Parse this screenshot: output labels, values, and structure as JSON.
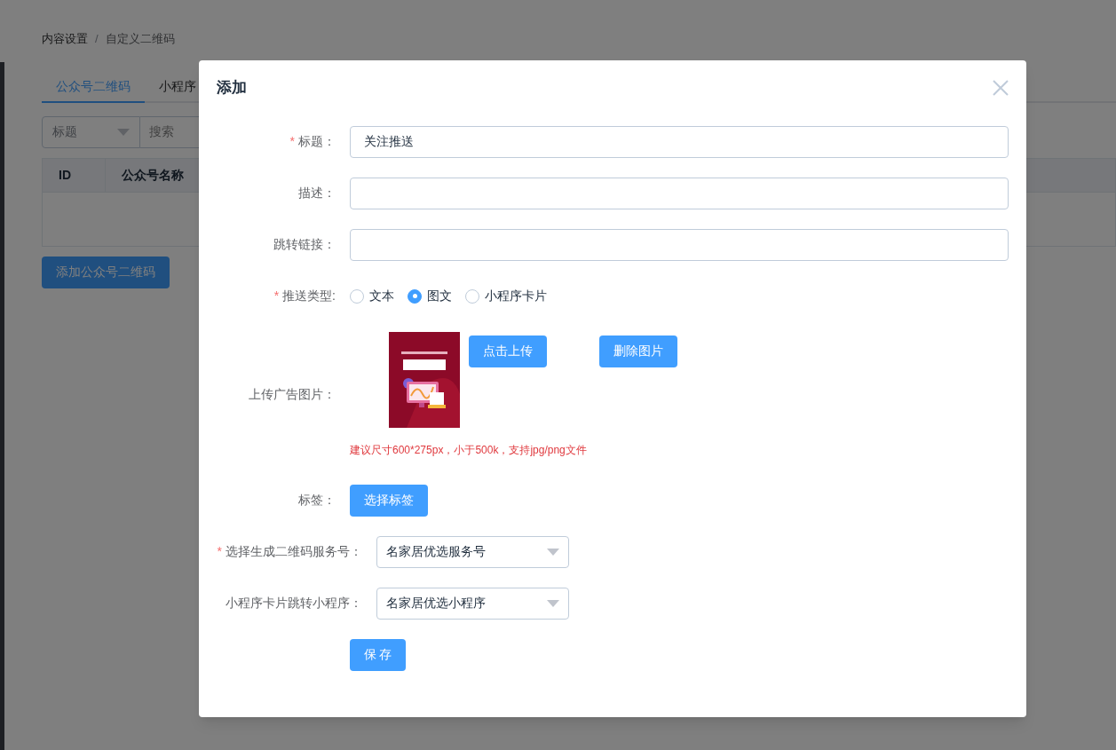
{
  "breadcrumb": [
    {
      "label": "内容设置"
    },
    {
      "label": "自定义二维码"
    }
  ],
  "breadcrumb_separator": "/",
  "tabs": [
    {
      "label": "公众号二维码",
      "selected": true
    },
    {
      "label": "小程序",
      "selected": false
    }
  ],
  "filter": {
    "select_value": "标题",
    "search_placeholder": "搜索"
  },
  "table": {
    "columns": [
      "ID",
      "公众号名称"
    ]
  },
  "add_button": "添加公众号二维码",
  "dialog": {
    "title": "添加",
    "fields": [
      {
        "kind": "input",
        "label": "标题：",
        "required": true,
        "value": "关注推送"
      },
      {
        "kind": "input",
        "label": "描述：",
        "required": false
      },
      {
        "kind": "input",
        "label": "跳转链接：",
        "required": false
      },
      {
        "kind": "radio",
        "label": "推送类型:",
        "required": true,
        "options": [
          {
            "label": "文本",
            "selected": false
          },
          {
            "label": "图文",
            "selected": true
          },
          {
            "label": "小程序卡片",
            "selected": false
          }
        ]
      },
      {
        "kind": "upload",
        "label": "上传广告图片：",
        "required": false,
        "buttons": [
          "点击上传",
          "删除图片"
        ],
        "hint": "建议尺寸600*275px，小于500k，支持jpg/png文件"
      },
      {
        "kind": "button",
        "label": "标签：",
        "required": false,
        "button": "选择标签"
      },
      {
        "kind": "select",
        "label": "选择生成二维码服务号：",
        "required": true,
        "value": "名家居优选服务号"
      },
      {
        "kind": "select",
        "label": "小程序卡片跳转小程序：",
        "required": false,
        "value": "名家居优选小程序"
      }
    ],
    "required_mark": "*",
    "save_button": "保 存"
  }
}
